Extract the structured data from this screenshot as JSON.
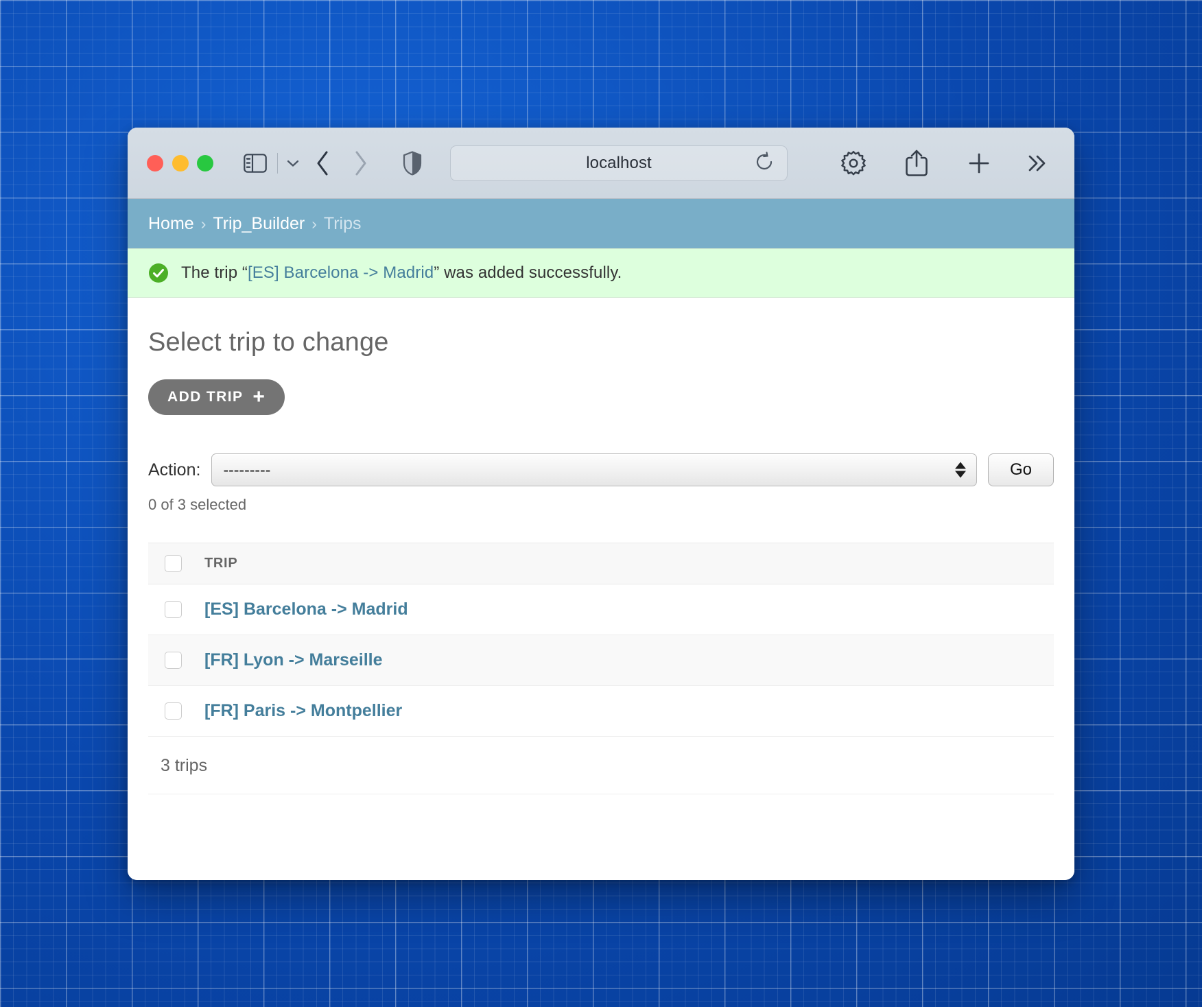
{
  "browser": {
    "url": "localhost",
    "traffic_lights": [
      "close",
      "minimize",
      "maximize"
    ],
    "icons": {
      "sidebar": "sidebar-icon",
      "tab_overview": "chevron-down-icon",
      "back": "back-chevron-icon",
      "forward": "forward-chevron-icon",
      "shield": "privacy-shield-icon",
      "reload": "reload-icon",
      "settings": "gear-icon",
      "share": "share-icon",
      "new_tab": "plus-icon",
      "more": "more-chevrons-icon"
    }
  },
  "breadcrumb": {
    "items": [
      {
        "label": "Home",
        "current": false
      },
      {
        "label": "Trip_Builder",
        "current": false
      },
      {
        "label": "Trips",
        "current": true
      }
    ],
    "separator": "›"
  },
  "message": {
    "icon": "success-check-icon",
    "prefix": "The trip “",
    "object": "[ES] Barcelona -> Madrid",
    "suffix": "” was added successfully."
  },
  "page": {
    "title": "Select trip to change",
    "add_button_label": "ADD TRIP",
    "add_button_glyph": "+"
  },
  "actions": {
    "label": "Action:",
    "selected_option": "---------",
    "options": [
      "---------"
    ],
    "go_label": "Go",
    "counter": "0 of 3 selected"
  },
  "table": {
    "columns": [
      "TRIP"
    ],
    "select_all_name": "select-all-checkbox",
    "rows": [
      {
        "trip": "[ES] Barcelona -> Madrid"
      },
      {
        "trip": "[FR] Lyon -> Marseille"
      },
      {
        "trip": "[FR] Paris -> Montpellier"
      }
    ]
  },
  "paginator": {
    "count_label": "3 trips"
  },
  "colors": {
    "breadcrumb_bg": "#79aec8",
    "success_bg": "#ddffdd",
    "link": "#447e9b",
    "add_button": "#747474",
    "desktop": "#0c50bf"
  }
}
